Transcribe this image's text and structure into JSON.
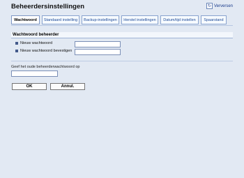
{
  "header": {
    "title": "Beheerdersinstellingen",
    "refresh_label": "Verversen",
    "refresh_icon": "refresh-icon"
  },
  "tabs": [
    {
      "label": "Wachtwoord",
      "active": true
    },
    {
      "label": "Standaard instelling",
      "active": false
    },
    {
      "label": "Backup-instellingen",
      "active": false
    },
    {
      "label": "Herstel instellingen",
      "active": false
    },
    {
      "label": "Datum/tijd instellen",
      "active": false
    },
    {
      "label": "Spaarstand",
      "active": false
    }
  ],
  "section": {
    "title": "Wachtwoord beheerder",
    "fields": [
      {
        "label": "Nieuw wachtwoord",
        "value": ""
      },
      {
        "label": "Nieuw wachtwoord bevestigen",
        "value": ""
      }
    ]
  },
  "old_password": {
    "label": "Geef het oude beheerderwachtwoord op",
    "value": ""
  },
  "buttons": {
    "ok": "OK",
    "cancel": "Annul."
  }
}
